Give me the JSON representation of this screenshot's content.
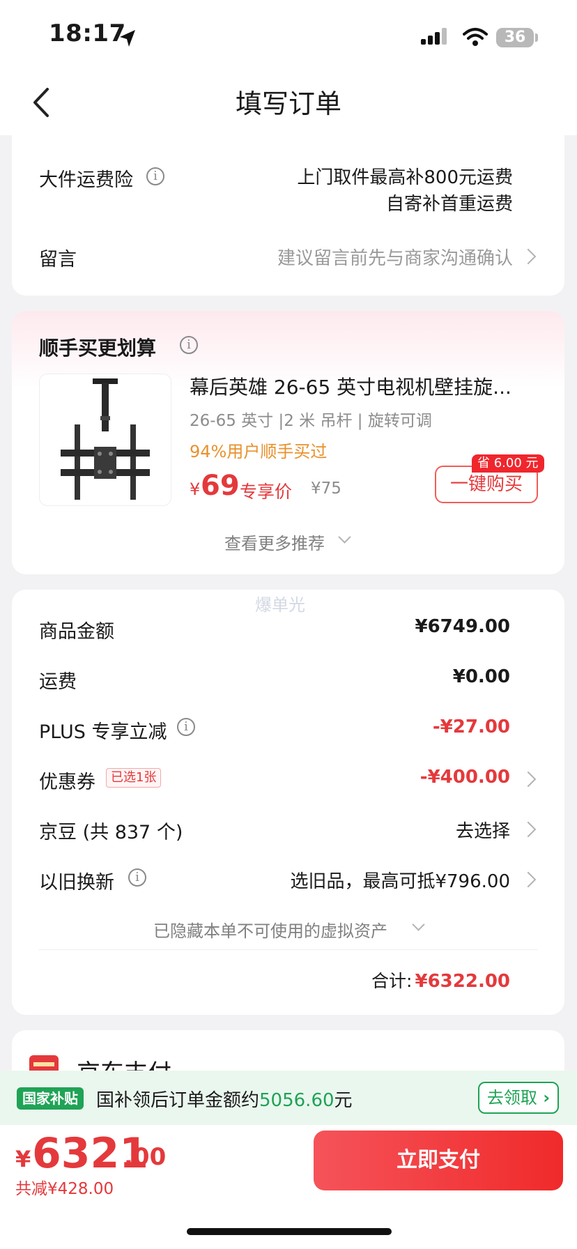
{
  "status_bar": {
    "time": "18:17",
    "battery": "36"
  },
  "nav": {
    "title": "填写订单"
  },
  "shipping_insurance": {
    "label": "大件运费险",
    "line1": "上门取件最高补800元运费",
    "line2": "自寄补首重运费"
  },
  "message": {
    "label": "留言",
    "placeholder": "建议留言前先与商家沟通确认"
  },
  "addon": {
    "title": "顺手买更划算",
    "product_name": "幕后英雄 26-65 英寸电视机壁挂旋...",
    "spec": "26-65 英寸 |2 米 吊杆 | 旋转可调",
    "social_proof": "94%用户顺手买过",
    "currency": "¥",
    "price": "69",
    "price_tag": "专享价",
    "original_price": "¥75",
    "save_badge": "省 6.00 元",
    "buy_button": "一键购买",
    "more": "查看更多推荐"
  },
  "watermark": "爆单光",
  "summary": {
    "rows": [
      {
        "label": "商品金额",
        "value": "¥6749.00"
      },
      {
        "label": "运费",
        "value": "¥0.00"
      },
      {
        "label": "PLUS 专享立减",
        "value": "-¥27.00"
      },
      {
        "label": "优惠券",
        "tag": "已选1张",
        "value": "-¥400.00"
      },
      {
        "label": "京豆 (共 837 个)",
        "value": "去选择"
      },
      {
        "label": "以旧换新",
        "value": "选旧品，最高可抵¥796.00"
      }
    ],
    "hidden_assets": "已隐藏本单不可使用的虚拟资产",
    "total_label": "合计:",
    "total_value": "¥6322.00"
  },
  "payment": {
    "method_label": "京东支付"
  },
  "subsidy": {
    "badge": "国家补贴",
    "text_prefix": "国补领后订单金额约",
    "amount": "5056.60",
    "unit": "元",
    "claim_button": "去领取"
  },
  "checkout": {
    "currency": "¥",
    "amount_int": "6321",
    "amount_dec": ".00",
    "saved": "共减¥428.00",
    "pay_button": "立即支付"
  },
  "colors": {
    "accent_red": "#e4393c",
    "green": "#1fa356",
    "orange": "#e8912c"
  }
}
